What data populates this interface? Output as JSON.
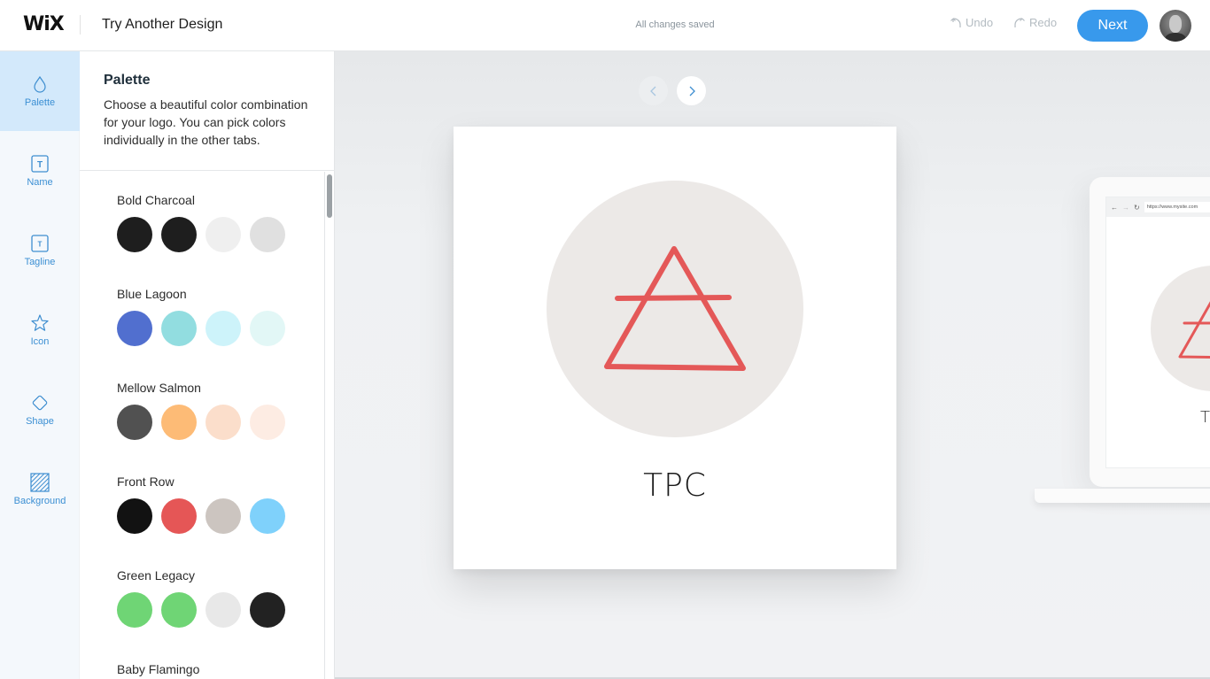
{
  "header": {
    "logo": "WiX",
    "title": "Try Another Design",
    "save_status": "All changes saved",
    "undo_label": "Undo",
    "redo_label": "Redo",
    "next_label": "Next",
    "accent_color": "#3899ec"
  },
  "nav": {
    "items": [
      {
        "label": "Palette",
        "icon": "droplet-icon",
        "active": true
      },
      {
        "label": "Name",
        "icon": "text-box-icon",
        "active": false
      },
      {
        "label": "Tagline",
        "icon": "text-box-small-icon",
        "active": false
      },
      {
        "label": "Icon",
        "icon": "star-icon",
        "active": false
      },
      {
        "label": "Shape",
        "icon": "diamond-icon",
        "active": false
      },
      {
        "label": "Background",
        "icon": "hatched-square-icon",
        "active": false
      }
    ]
  },
  "panel": {
    "title": "Palette",
    "description": "Choose a beautiful color combination for your logo. You can pick colors individually in the other tabs.",
    "palettes": [
      {
        "name": "Bold Charcoal",
        "colors": [
          "#1e1e1e",
          "#1e1e1e",
          "#efefef",
          "#e0e0e0"
        ]
      },
      {
        "name": "Blue Lagoon",
        "colors": [
          "#516fcf",
          "#92dde0",
          "#cdf3fa",
          "#e2f7f6"
        ]
      },
      {
        "name": "Mellow Salmon",
        "colors": [
          "#515151",
          "#fdbb76",
          "#fbdecb",
          "#fdece3"
        ]
      },
      {
        "name": "Front Row",
        "colors": [
          "#121212",
          "#e55656",
          "#ccc5c0",
          "#7fd1fb"
        ]
      },
      {
        "name": "Green Legacy",
        "colors": [
          "#6fd575",
          "#6fd575",
          "#e8e8e8",
          "#222222"
        ]
      },
      {
        "name": "Baby Flamingo",
        "colors": []
      }
    ]
  },
  "canvas": {
    "logo_text": "TPC",
    "logo_symbol": "air-element-triangle",
    "logo_symbol_color": "#e45858",
    "logo_circle_color": "#ece9e7",
    "preview": {
      "url": "https://www.mysite.com",
      "text_partial": "T"
    }
  }
}
